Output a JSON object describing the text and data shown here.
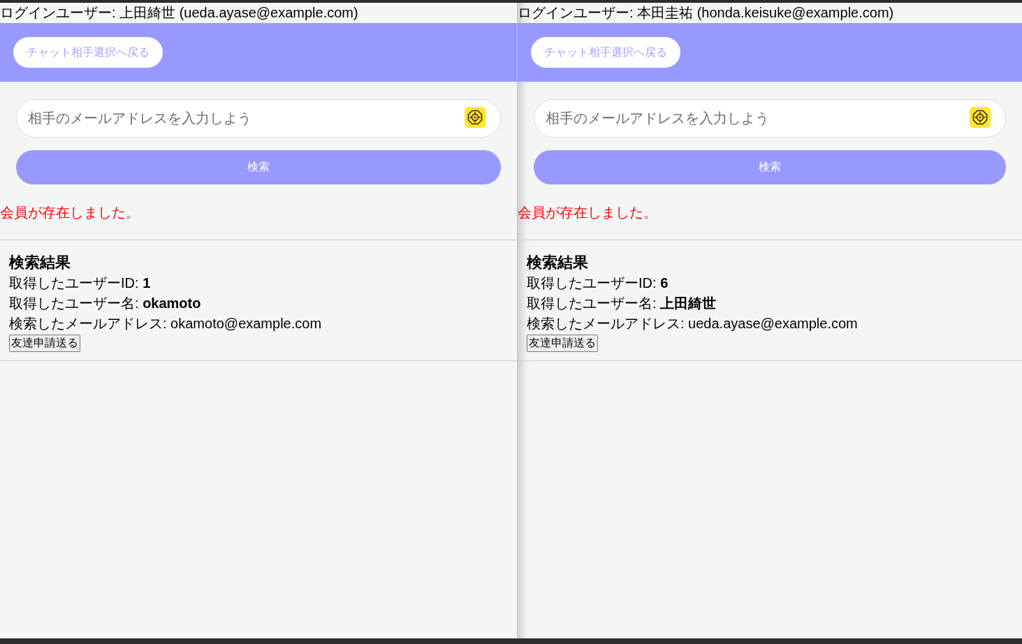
{
  "windows": [
    {
      "login_label": "ログインユーザー: 上田綺世 (ueda.ayase@example.com)",
      "back_button": "チャット相手選択へ戻る",
      "search_field": {
        "placeholder": "相手のメールアドレスを入力しよう"
      },
      "search_button": "検索",
      "message": "会員が存在しました。",
      "result": {
        "heading": "検索結果",
        "lines": [
          "取得したユーザーID: **1**",
          "取得したユーザー名: **okamoto**",
          "検索したメールアドレス: okamoto@example.com"
        ],
        "friend_request_button": "友達申請送る"
      }
    },
    {
      "login_label": "ログインユーザー: 本田圭祐 (honda.keisuke@example.com)",
      "back_button": "チャット相手選択へ戻る",
      "search_field": {
        "placeholder": "相手のメールアドレスを入力しよう"
      },
      "search_button": "検索",
      "message": "会員が存在しました。",
      "result": {
        "heading": "検索結果",
        "lines": [
          "取得したユーザーID: **6**",
          "取得したユーザー名: **上田綺世**",
          "検索したメールアドレス: ueda.ayase@example.com"
        ],
        "friend_request_button": "友達申請送る"
      }
    }
  ]
}
